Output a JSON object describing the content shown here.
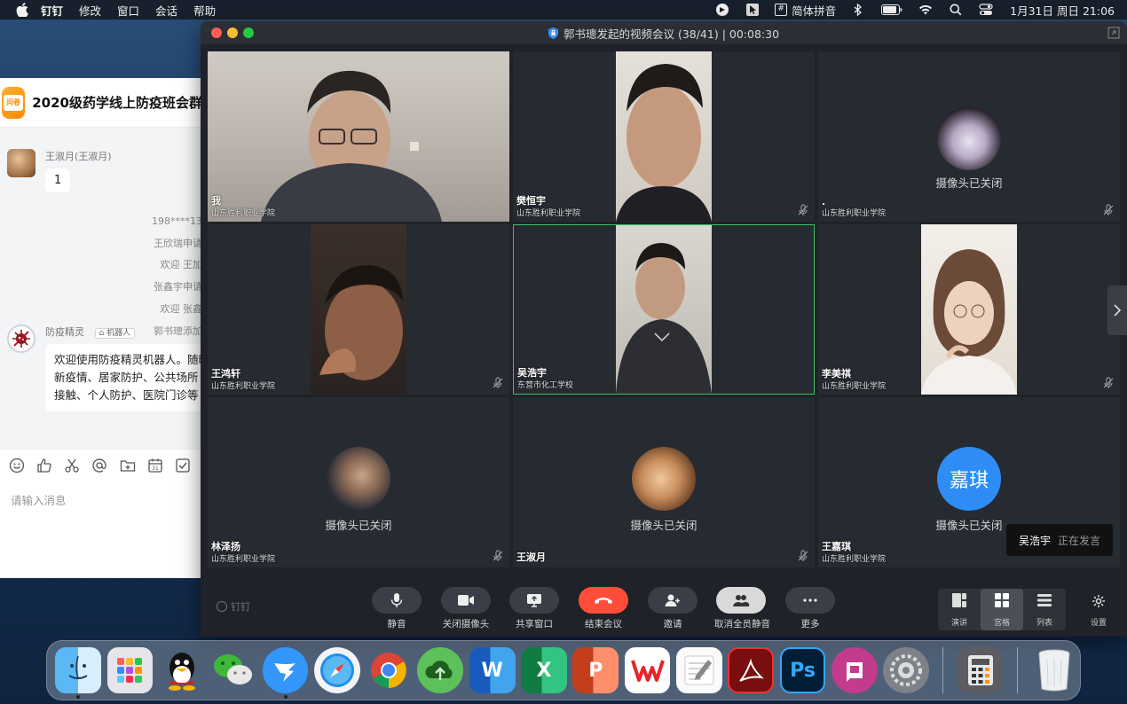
{
  "menubar": {
    "app_name": "钉钉",
    "menus": [
      "修改",
      "窗口",
      "会话",
      "帮助"
    ],
    "ime_label": "简体拼音",
    "clock": "1月31日 周日 21:06"
  },
  "chat": {
    "group_title": "2020级药学线上防疫班会群",
    "group_icon_text": "问卷",
    "msg1_sender": "王淑月(王淑月)",
    "msg1_text": "1",
    "system_lines": [
      "198****13",
      "王欣瑞申请",
      "欢迎 王加",
      "张鑫宇申请",
      "欢迎 张鑫",
      "郭书璁添加"
    ],
    "bot_sender": "防疫精灵",
    "bot_tag": "机器人",
    "bot_lines": [
      "欢迎使用防疫精灵机器人。随时",
      "新疫情、居家防护、公共场所",
      "接触、个人防护、医院门诊等"
    ],
    "input_placeholder": "请输入消息"
  },
  "meeting": {
    "title": "郭书璁发起的视频会议 (38/41) | 00:08:30",
    "camera_off_label": "摄像头已关闭",
    "tiles": [
      {
        "name": "我",
        "org": "山东胜利职业学院"
      },
      {
        "name": "樊恒宇",
        "org": "山东胜利职业学院"
      },
      {
        "name": ".",
        "org": "山东胜利职业学院"
      },
      {
        "name": "王鸿轩",
        "org": "山东胜利职业学院"
      },
      {
        "name": "吴浩宇",
        "org": "东营市化工学校"
      },
      {
        "name": "李美祺",
        "org": "山东胜利职业学院"
      },
      {
        "name": "林泽扬",
        "org": "山东胜利职业学院"
      },
      {
        "name": "王淑月",
        "org": ""
      },
      {
        "name": "王嘉琪",
        "org": "山东胜利职业学院",
        "avatar_text": "嘉琪"
      }
    ],
    "speaking": {
      "name": "吴浩宇",
      "status": "正在发言"
    },
    "brand": "钉钉",
    "controls": [
      "静音",
      "关闭摄像头",
      "共享窗口",
      "结束会议",
      "邀请",
      "取消全员静音",
      "更多"
    ],
    "layouts": [
      "演讲",
      "宫格",
      "列表"
    ],
    "settings_label": "设置"
  },
  "dock": {
    "apps": [
      "finder-icon",
      "launchpad-icon",
      "qq-icon",
      "wechat-icon",
      "dingtalk-icon",
      "safari-icon",
      "chrome-icon",
      "cloud-icon",
      "word-icon",
      "excel-icon",
      "powerpoint-icon",
      "wps-icon",
      "textedit-icon",
      "acrobat-icon",
      "photoshop-icon",
      "notes-app-icon",
      "system-preferences-icon",
      "calculator-icon",
      "trash-icon"
    ],
    "word_letter": "W",
    "excel_letter": "X",
    "ppt_letter": "P",
    "ps_letters": "Ps"
  }
}
